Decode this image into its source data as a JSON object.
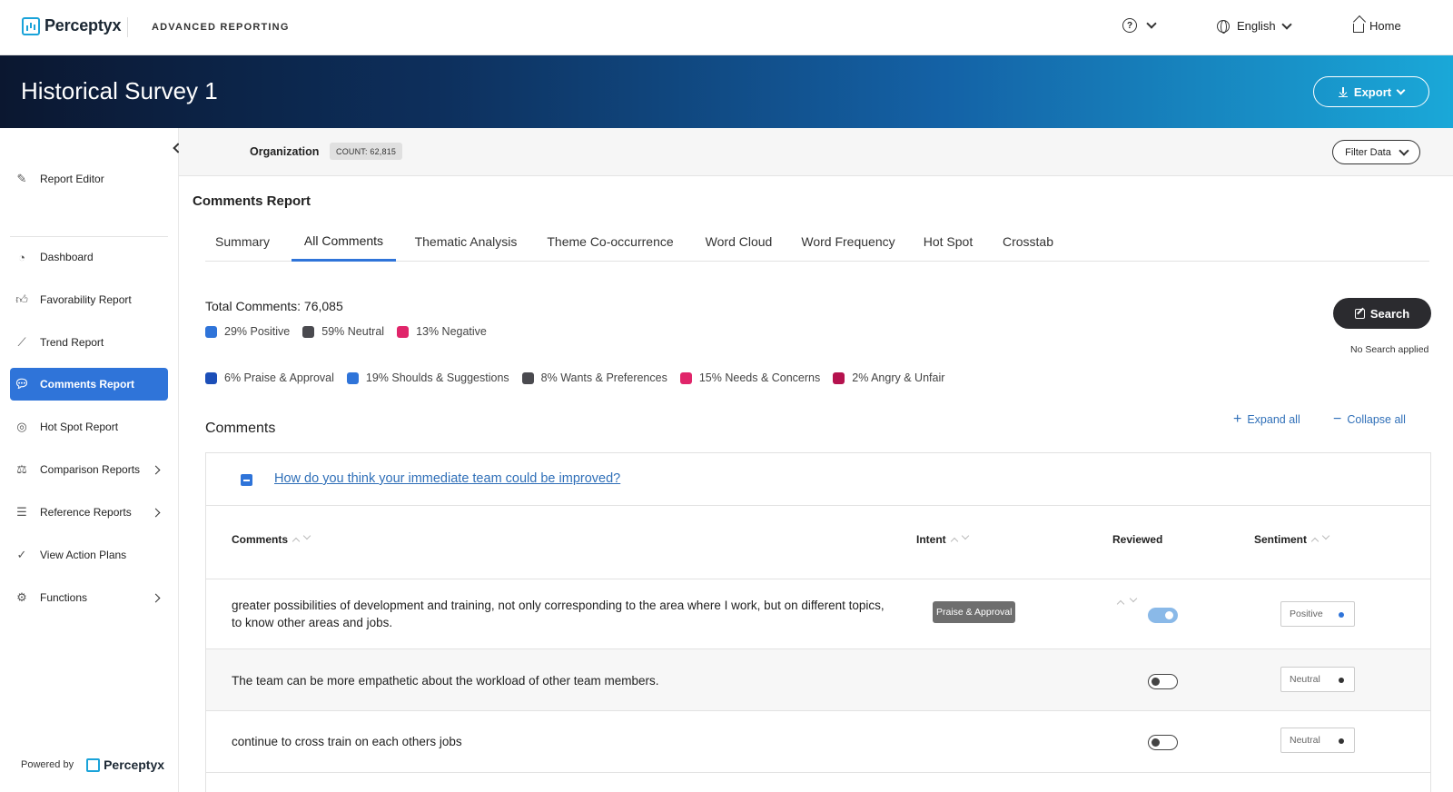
{
  "brand": {
    "name": "Perceptyx",
    "app_name": "ADVANCED REPORTING"
  },
  "topnav": {
    "help_icon": "question-circle-icon",
    "language": "English",
    "home_label": "Home"
  },
  "banner": {
    "title": "Historical Survey 1",
    "export_label": "Export"
  },
  "sidebar": {
    "items": [
      {
        "label": "Report Editor",
        "icon": "pencil-icon"
      },
      {
        "label": "Dashboard",
        "icon": "gauge-icon"
      },
      {
        "label": "Favorability Report",
        "icon": "thumbs-up-icon"
      },
      {
        "label": "Trend Report",
        "icon": "trend-icon"
      },
      {
        "label": "Comments Report",
        "icon": "comments-icon",
        "active": true
      },
      {
        "label": "Hot Spot Report",
        "icon": "target-icon"
      },
      {
        "label": "Comparison Reports",
        "icon": "scale-icon"
      },
      {
        "label": "Reference Reports",
        "icon": "bar-chart-icon"
      },
      {
        "label": "View Action Plans",
        "icon": "check-circle-icon"
      },
      {
        "label": "Functions",
        "icon": "gear-icon"
      }
    ],
    "powered_by": "Powered by",
    "powered_brand": "Perceptyx"
  },
  "orgbar": {
    "label": "Organization",
    "count": "COUNT: 62,815",
    "filter_label": "Filter Data"
  },
  "main": {
    "title": "Comments Report",
    "tabs": [
      "Summary",
      "All Comments",
      "Thematic Analysis",
      "Theme Co-occurrence",
      "Word Cloud",
      "Word Frequency",
      "Hot Spot",
      "Crosstab"
    ],
    "active_tab": "All Comments",
    "total_comments": "Total Comments: 76,085",
    "sentiment_legend": [
      {
        "label": "29% Positive",
        "color": "#2f74d9"
      },
      {
        "label": "59% Neutral",
        "color": "#4a4a4f"
      },
      {
        "label": "13% Negative",
        "color": "#e0256a"
      }
    ],
    "intent_legend": [
      {
        "label": "6% Praise & Approval",
        "color": "#1c4fb8"
      },
      {
        "label": "19% Shoulds & Suggestions",
        "color": "#2f74d9"
      },
      {
        "label": "8% Wants & Preferences",
        "color": "#4a4a4f"
      },
      {
        "label": "15% Needs & Concerns",
        "color": "#e0256a"
      },
      {
        "label": "2% Angry & Unfair",
        "color": "#b5124e"
      }
    ],
    "search_label": "Search",
    "no_search": "No Search applied",
    "comments_heading": "Comments",
    "expand_all": "Expand all",
    "collapse_all": "Collapse all"
  },
  "table": {
    "question": "How do you think your immediate team could be improved?",
    "columns": {
      "comments": "Comments",
      "intent": "Intent",
      "reviewed": "Reviewed",
      "sentiment": "Sentiment"
    },
    "rows": [
      {
        "comment": "greater possibilities of development and training, not only corresponding to the area where I work, but on different topics, to know other areas and jobs.",
        "intent": "Praise & Approval",
        "reviewed": true,
        "sentiment": "Positive",
        "sentiment_color": "#2f74d9"
      },
      {
        "comment": "The team can be more empathetic about the workload of other team members.",
        "intent": "",
        "reviewed": false,
        "sentiment": "Neutral",
        "sentiment_color": "#333333"
      },
      {
        "comment": "continue to cross train on each others jobs",
        "intent": "",
        "reviewed": false,
        "sentiment": "Neutral",
        "sentiment_color": "#333333"
      }
    ]
  }
}
